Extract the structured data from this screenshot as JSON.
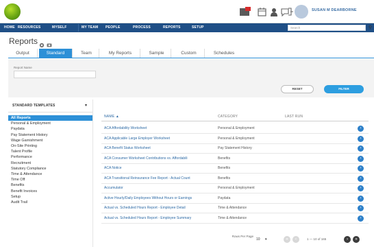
{
  "user": {
    "name": "SUSAN M DEARBORNE"
  },
  "nav": {
    "items": [
      "HOME",
      "RESOURCES",
      "MYSELF",
      "MY TEAM",
      "PEOPLE",
      "PROCESS",
      "REPORTS",
      "SETUP"
    ],
    "search_placeholder": "Search"
  },
  "page": {
    "title": "Reports"
  },
  "tabs": [
    "Output",
    "Standard",
    "Team",
    "My Reports",
    "Sample",
    "Custom",
    "Schedules"
  ],
  "filter": {
    "name_label": "Report Name",
    "reset_label": "RESET",
    "filter_label": "FILTER"
  },
  "sidebar": {
    "heading": "STANDARD TEMPLATES",
    "items": [
      "All Reports",
      "Personal & Employment",
      "Paydata",
      "Pay Statement History",
      "Wage Garnishment",
      "On-Site Printing",
      "Talent Profile",
      "Performance",
      "Recruitment",
      "Statutory Compliance",
      "Time & Attendance",
      "Time Off",
      "Benefits",
      "Benefit Invoices",
      "Setup",
      "Audit Trail"
    ]
  },
  "table": {
    "headers": {
      "name": "NAME",
      "category": "CATEGORY",
      "last_run": "LAST RUN"
    },
    "rows": [
      {
        "name": "ACA Affordability Worksheet",
        "category": "Personal & Employment"
      },
      {
        "name": "ACA Applicable Large Employer Worksheet",
        "category": "Personal & Employment"
      },
      {
        "name": "ACA Benefit Status Worksheet",
        "category": "Pay Statement History"
      },
      {
        "name": "ACA Consumer Worksheet Contributions vs. Affordabili",
        "category": "Benefits"
      },
      {
        "name": "ACA Notice",
        "category": "Benefits"
      },
      {
        "name": "ACA Transitional Reinsurance Fee Report - Actual Count",
        "category": "Benefits"
      },
      {
        "name": "Accumulator",
        "category": "Personal & Employment"
      },
      {
        "name": "Active Hourly/Daily Employees Without Hours or Earnings",
        "category": "Paydata"
      },
      {
        "name": "Actual vs. Scheduled Hours Report - Employee Detail",
        "category": "Time & Attendance"
      },
      {
        "name": "Actual vs. Scheduled Hours Report - Employee Summary",
        "category": "Time & Attendance"
      }
    ]
  },
  "pager": {
    "rows_per_page_label": "Rows Per Page",
    "rows_per_page": "10",
    "count": "1 — 10 of 165"
  }
}
